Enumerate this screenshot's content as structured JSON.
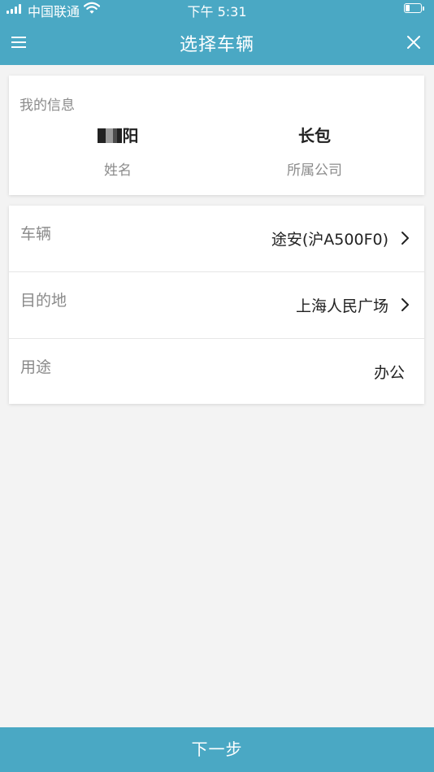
{
  "status_bar": {
    "carrier": "中国联通",
    "time": "下午 5:31",
    "battery_level": 0.25
  },
  "header": {
    "title": "选择车辆",
    "menu_icon": "menu-icon",
    "close_icon": "close-icon",
    "background_color": "#4aa8c4"
  },
  "my_info": {
    "title": "我的信息",
    "name_value": "阳",
    "name_label": "姓名",
    "company_value": "长包",
    "company_label": "所属公司"
  },
  "form": {
    "vehicle": {
      "label": "车辆",
      "value": "途安(沪A500F0)"
    },
    "destination": {
      "label": "目的地",
      "value": "上海人民广场"
    },
    "purpose": {
      "label": "用途",
      "value": "办公"
    }
  },
  "footer": {
    "next_label": "下一步"
  }
}
